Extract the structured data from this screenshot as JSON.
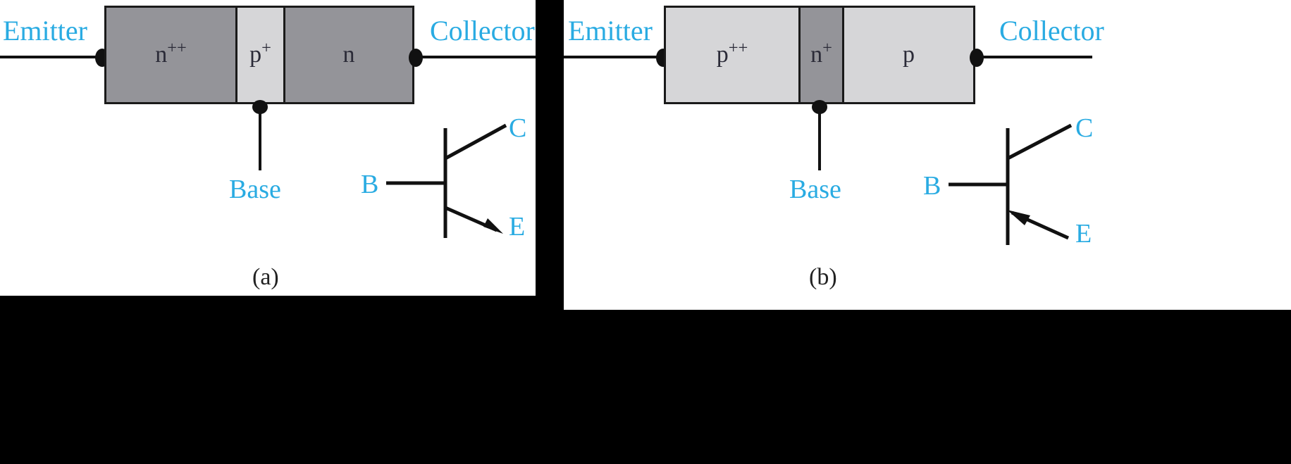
{
  "figure": {
    "background": "#000000",
    "panel_background": "#ffffff",
    "label_color": "#29ABE2",
    "line_color": "#111111",
    "dark_fill": "#949499",
    "light_fill": "#d6d6d8",
    "text_fill": "#2b2b38"
  },
  "panels": [
    {
      "id": "a",
      "caption": "(a)",
      "type": "npn",
      "emitter_label": "Emitter",
      "collector_label": "Collector",
      "base_label": "Base",
      "regions": [
        {
          "name": "emitter-region",
          "base": "n",
          "sup": "++",
          "shade": "dark"
        },
        {
          "name": "base-region",
          "base": "p",
          "sup": "+",
          "shade": "light"
        },
        {
          "name": "collector-region",
          "base": "n",
          "sup": "",
          "shade": "dark"
        }
      ],
      "symbol": {
        "base_terminal": "B",
        "collector_terminal": "C",
        "emitter_terminal": "E",
        "arrow_on": "emitter",
        "arrow_direction": "outward"
      }
    },
    {
      "id": "b",
      "caption": "(b)",
      "type": "pnp",
      "emitter_label": "Emitter",
      "collector_label": "Collector",
      "base_label": "Base",
      "regions": [
        {
          "name": "emitter-region",
          "base": "p",
          "sup": "++",
          "shade": "light"
        },
        {
          "name": "base-region",
          "base": "n",
          "sup": "+",
          "shade": "dark"
        },
        {
          "name": "collector-region",
          "base": "p",
          "sup": "",
          "shade": "light"
        }
      ],
      "symbol": {
        "base_terminal": "B",
        "collector_terminal": "C",
        "emitter_terminal": "E",
        "arrow_on": "emitter",
        "arrow_direction": "inward"
      }
    }
  ]
}
